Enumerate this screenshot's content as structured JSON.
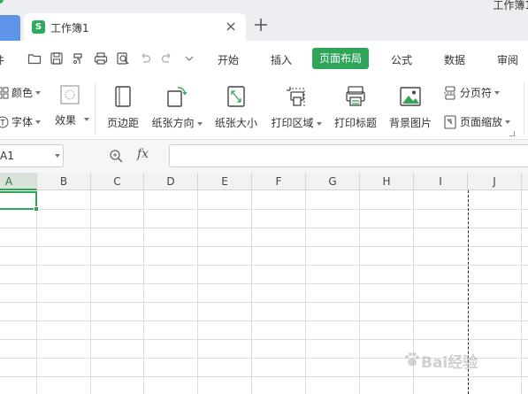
{
  "titlebar": {
    "tab_title": "工作簿1",
    "tab_icon_letter": "S",
    "app_title": "工作簿1"
  },
  "menubar": {
    "file_label": "件",
    "tabs": [
      {
        "label": "开始",
        "active": false
      },
      {
        "label": "插入",
        "active": false
      },
      {
        "label": "页面布局",
        "active": true
      },
      {
        "label": "公式",
        "active": false
      },
      {
        "label": "数据",
        "active": false
      },
      {
        "label": "审阅",
        "active": false
      }
    ]
  },
  "ribbon": {
    "color_label": "颜色",
    "font_label": "字体",
    "effects_label": "效果",
    "margins_label": "页边距",
    "orientation_label": "纸张方向",
    "size_label": "纸张大小",
    "print_area_label": "打印区域",
    "print_titles_label": "打印标题",
    "background_label": "背景图片",
    "page_break_label": "分页符",
    "page_zoom_label": "页面缩放"
  },
  "formulabar": {
    "namebox_value": "A1",
    "fx_label": "fx",
    "formula_value": ""
  },
  "sheet": {
    "columns": [
      "A",
      "B",
      "C",
      "D",
      "E",
      "F",
      "G",
      "H",
      "I",
      "J"
    ],
    "selected_column": "A",
    "active_cell": "A1"
  },
  "watermark": {
    "text": "Bai经验"
  },
  "colors": {
    "accent": "#2fa55a",
    "home_tab": "#5f95e8",
    "titlebar_bg": "#eceef1"
  }
}
